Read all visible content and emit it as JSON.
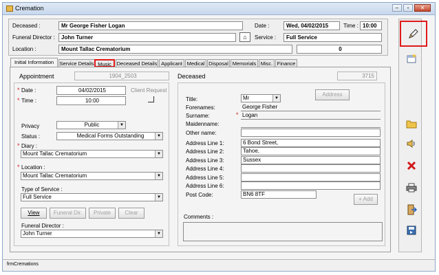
{
  "window": {
    "title": "Cremation",
    "min": "–",
    "max": "▫",
    "close": "✕"
  },
  "header": {
    "deceased_label": "Deceased :",
    "deceased_value": "Mr George Fisher Logan",
    "date_label": "Date :",
    "date_value": "Wed, 04/02/2015",
    "time_label": "Time :",
    "time_value": "10:00",
    "director_label": "Funeral Director :",
    "director_value": "John Turner",
    "service_label": "Service :",
    "service_value": "Full Service",
    "location_label": "Location :",
    "location_value": "Mount Tallac Crematorium",
    "count_value": "0"
  },
  "tabs": [
    "Initial Information",
    "Service Details",
    "Music",
    "Deceased Details",
    "Applicant",
    "Medical",
    "Disposal",
    "Memorials",
    "Misc.",
    "Finance"
  ],
  "appointment": {
    "label": "Appointment",
    "ref": "1904_2503",
    "date_label": "Date :",
    "date_value": "04/02/2015",
    "time_label": "Time :",
    "time_value": "10:00",
    "client_request": "Client Request",
    "privacy_label": "Privacy",
    "privacy_value": "Public",
    "status_label": "Status :",
    "status_value": "Medical Forms Outstanding",
    "diary_label": "Diary :",
    "diary_value": "Mount Tallac Crematorium",
    "location_label": "Location :",
    "location_value": "Mount Tallac Crematorium",
    "type_label": "Type of Service :",
    "type_value": "Full Service",
    "btn_view": "View",
    "btn_funeral": "Funeral Dir.",
    "btn_private": "Private",
    "btn_clear": "Clear",
    "director_label": "Funeral Director :",
    "director_value": "John Turner"
  },
  "deceased": {
    "label": "Deceased",
    "ref": "3715",
    "title_label": "Title:",
    "title_value": "Mr",
    "address_btn": "Address",
    "forenames_label": "Forenames:",
    "forenames_value": "George Fisher",
    "surname_label": "Surname:",
    "surname_value": "Logan",
    "maiden_label": "Maidenname:",
    "maiden_value": "",
    "other_label": "Other name:",
    "other_value": "",
    "addr1_label": "Address Line 1:",
    "addr1_value": "6 Bond Street,",
    "addr2_label": "Address Line 2:",
    "addr2_value": "Tahoe,",
    "addr3_label": "Address Line 3:",
    "addr3_value": "Sussex",
    "addr4_label": "Address Line 4:",
    "addr4_value": "",
    "addr5_label": "Address Line 5:",
    "addr5_value": "",
    "addr6_label": "Address Line 6:",
    "addr6_value": "",
    "postcode_label": "Post Code:",
    "postcode_value": "BN6 8TF",
    "add_btn": "+ Add",
    "comments_label": "Comments :"
  },
  "sidebar_icons": [
    "edit-icon",
    "new-record-icon",
    "folder-icon",
    "sound-icon",
    "delete-icon",
    "print-icon",
    "exit-icon",
    "save-icon"
  ],
  "status_bar": {
    "form_name": "frmCremations"
  },
  "colors": {
    "highlight": "#e01818",
    "title_bar": "#c7d7ec",
    "required": "#d02020"
  }
}
